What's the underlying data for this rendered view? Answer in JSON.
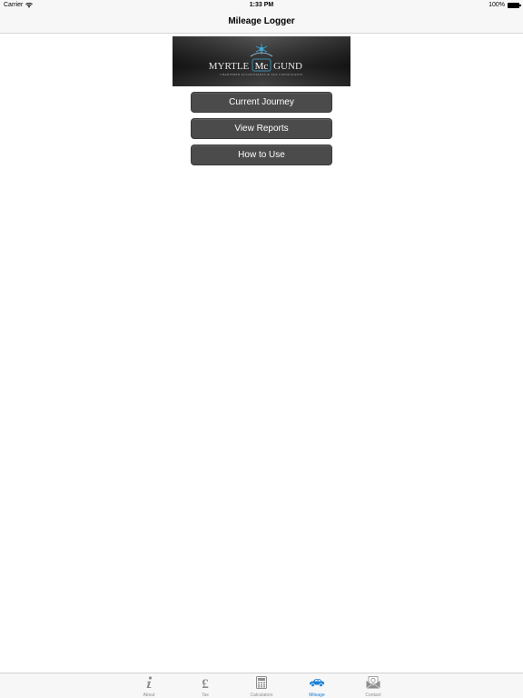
{
  "status_bar": {
    "carrier": "Carrier",
    "time": "1:33 PM",
    "battery": "100%"
  },
  "nav": {
    "title": "Mileage Logger"
  },
  "logo": {
    "brand_left": "MYRTLE",
    "brand_mid": "Mc",
    "brand_right": "GUND",
    "tagline": "CHARTERED ACCOUNTANTS & TAX CONSULTANTS"
  },
  "menu": {
    "current_journey": "Current Journey",
    "view_reports": "View Reports",
    "how_to_use": "How to Use"
  },
  "tabs": [
    {
      "label": "About",
      "icon": "info-icon"
    },
    {
      "label": "Tax",
      "icon": "pound-icon"
    },
    {
      "label": "Calculators",
      "icon": "calculator-icon"
    },
    {
      "label": "Mileage",
      "icon": "car-icon",
      "active": true
    },
    {
      "label": "Contact",
      "icon": "envelope-icon"
    }
  ],
  "colors": {
    "accent": "#1a7fd6",
    "button": "#4b4b4b",
    "inactive": "#8e8e8e"
  }
}
